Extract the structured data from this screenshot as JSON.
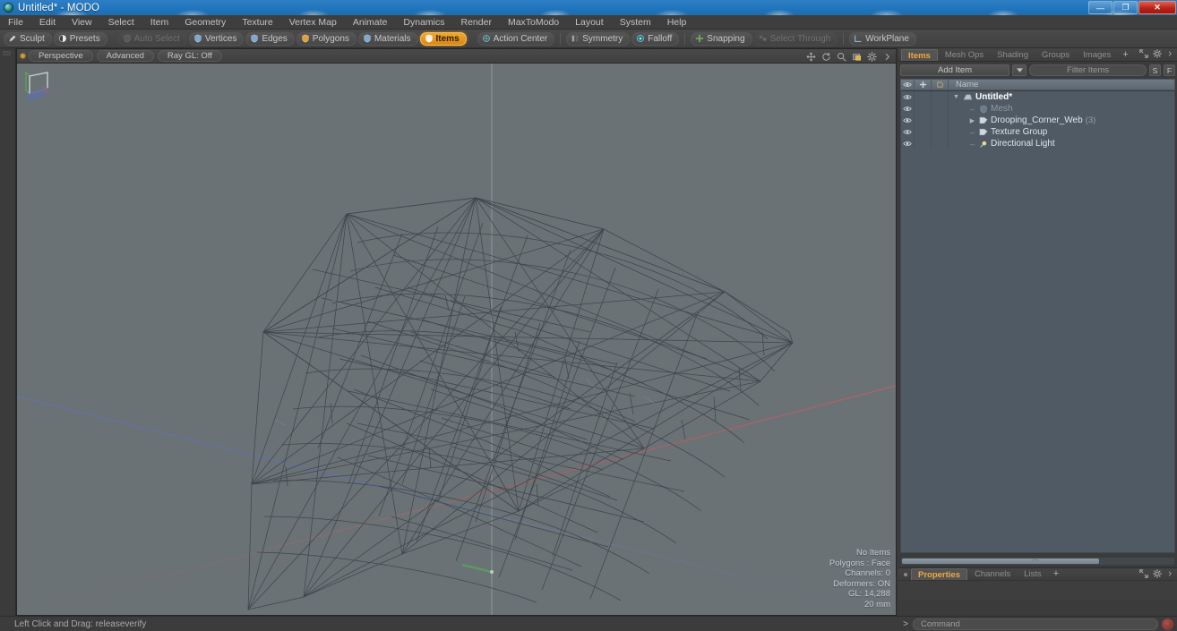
{
  "window": {
    "title": "Untitled* - MODO",
    "app_icon": "modo-orb-icon",
    "minimize_label": "—",
    "maximize_label": "❐",
    "close_label": "✕"
  },
  "menubar": {
    "items": [
      {
        "label": "File"
      },
      {
        "label": "Edit"
      },
      {
        "label": "View"
      },
      {
        "label": "Select"
      },
      {
        "label": "Item"
      },
      {
        "label": "Geometry"
      },
      {
        "label": "Texture"
      },
      {
        "label": "Vertex Map"
      },
      {
        "label": "Animate"
      },
      {
        "label": "Dynamics"
      },
      {
        "label": "Render"
      },
      {
        "label": "MaxToModo"
      },
      {
        "label": "Layout"
      },
      {
        "label": "System"
      },
      {
        "label": "Help"
      }
    ]
  },
  "toolbar": {
    "items": [
      {
        "label": "Sculpt",
        "icon": "pencil-icon",
        "state": "normal"
      },
      {
        "label": "Presets",
        "icon": "sphere-icon",
        "state": "normal"
      },
      {
        "label": "Auto Select",
        "icon": "shield-gray-icon",
        "state": "disabled"
      },
      {
        "label": "Vertices",
        "icon": "shield-blue-icon",
        "state": "normal"
      },
      {
        "label": "Edges",
        "icon": "shield-blue-icon",
        "state": "normal"
      },
      {
        "label": "Polygons",
        "icon": "shield-orange-icon",
        "state": "normal"
      },
      {
        "label": "Materials",
        "icon": "shield-blue-icon",
        "state": "normal"
      },
      {
        "label": "Items",
        "icon": "shield-white-icon",
        "state": "active"
      },
      {
        "label": "Action Center",
        "icon": "target-icon",
        "state": "normal"
      },
      {
        "label": "Symmetry",
        "icon": "mirror-icon",
        "state": "normal"
      },
      {
        "label": "Falloff",
        "icon": "falloff-icon",
        "state": "normal"
      },
      {
        "label": "Snapping",
        "icon": "snap-cross-icon",
        "state": "normal"
      },
      {
        "label": "Select Through",
        "icon": "select-through-icon",
        "state": "disabled"
      },
      {
        "label": "WorkPlane",
        "icon": "workplane-icon",
        "state": "normal"
      }
    ]
  },
  "viewport": {
    "header": {
      "indicator": "active-dot",
      "pills": [
        {
          "label": "Perspective"
        },
        {
          "label": "Advanced"
        },
        {
          "label": "Ray GL: Off"
        }
      ],
      "nav_icons": [
        {
          "name": "pan-icon"
        },
        {
          "name": "rotate-icon"
        },
        {
          "name": "zoom-icon"
        },
        {
          "name": "render-region-icon"
        },
        {
          "name": "gear-icon"
        },
        {
          "name": "chevron-right-icon"
        }
      ]
    },
    "stats": [
      "No Items",
      "Polygons : Face",
      "Channels: 0",
      "Deformers: ON",
      "GL: 14,288",
      "20 mm"
    ],
    "axis_colors": {
      "x": "#b05a5a",
      "y": "#5fa05f",
      "z": "#5a6fb5"
    },
    "background_color": "#6a7276",
    "wire_color": "#3c4449",
    "gizmo": "axis-cube-gizmo"
  },
  "right_panel": {
    "tabs": [
      {
        "label": "Items",
        "active": true
      },
      {
        "label": "Mesh Ops",
        "active": false
      },
      {
        "label": "Shading",
        "active": false
      },
      {
        "label": "Groups",
        "active": false
      },
      {
        "label": "Images",
        "active": false
      },
      {
        "label": "+",
        "active": false
      }
    ],
    "tab_icons": [
      "expand-icon",
      "gear-icon",
      "chevron-right-icon"
    ],
    "add_item": {
      "label": "Add Item",
      "dropdown_icon": "chevron-down-icon"
    },
    "filter": {
      "placeholder": "Filter Items"
    },
    "sf_buttons": [
      {
        "label": "S"
      },
      {
        "label": "F"
      }
    ],
    "list_header": {
      "col_eye": "eye-icon",
      "col_lock": "plus-icon",
      "col_render": "render-icon",
      "col_name": "Name"
    },
    "items": [
      {
        "label": "Untitled*",
        "indent": 0,
        "twirl": "open",
        "icon": "scene-icon",
        "style": "bold",
        "count": ""
      },
      {
        "label": "Mesh",
        "indent": 1,
        "twirl": "none",
        "icon": "mesh-icon",
        "style": "dim",
        "count": ""
      },
      {
        "label": "Drooping_Corner_Web",
        "indent": 1,
        "twirl": "closed",
        "icon": "mesh-item-icon",
        "style": "normal",
        "count": "(3)"
      },
      {
        "label": "Texture Group",
        "indent": 1,
        "twirl": "none",
        "icon": "group-icon",
        "style": "normal",
        "count": ""
      },
      {
        "label": "Directional Light",
        "indent": 1,
        "twirl": "none",
        "icon": "light-icon",
        "style": "normal",
        "count": ""
      }
    ],
    "bottom_tabs": [
      {
        "label": "Properties",
        "active": true
      },
      {
        "label": "Channels",
        "active": false
      },
      {
        "label": "Lists",
        "active": false
      },
      {
        "label": "+",
        "active": false
      }
    ],
    "bottom_tab_icons": [
      "expand-icon",
      "gear-icon",
      "chevron-right-icon"
    ]
  },
  "statusbar": {
    "text": "Left Click and Drag:  releaseverify"
  },
  "command": {
    "caret": ">",
    "placeholder": "Command",
    "record_icon": "record-icon"
  },
  "colors": {
    "accent_orange": "#f0a830",
    "title_blue": "#2277be",
    "panel_gray": "#3b3b3b",
    "list_slate": "#4f5a64",
    "viewport_bg": "#6a7276"
  }
}
